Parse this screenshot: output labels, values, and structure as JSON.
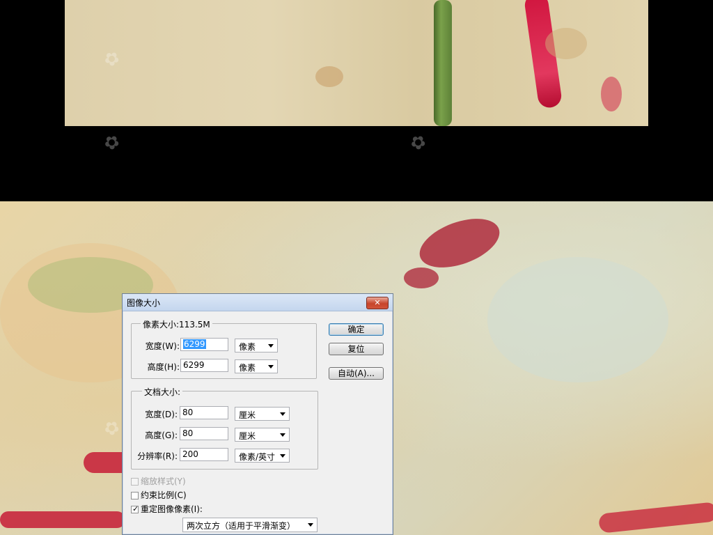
{
  "dialog": {
    "title": "图像大小",
    "close_icon": "close-icon",
    "pixel_dimensions": {
      "label": "像素大小:113.5M",
      "width_label": "宽度(W):",
      "width_value": "6299",
      "width_unit": "像素",
      "height_label": "高度(H):",
      "height_value": "6299",
      "height_unit": "像素"
    },
    "document_size": {
      "label": "文档大小:",
      "width_label": "宽度(D):",
      "width_value": "80",
      "width_unit": "厘米",
      "height_label": "高度(G):",
      "height_value": "80",
      "height_unit": "厘米",
      "resolution_label": "分辨率(R):",
      "resolution_value": "200",
      "resolution_unit": "像素/英寸"
    },
    "buttons": {
      "ok": "确定",
      "reset": "复位",
      "auto": "自动(A)..."
    },
    "options": {
      "scale_styles": "缩放样式(Y)",
      "scale_styles_checked": false,
      "scale_styles_disabled": true,
      "constrain": "约束比例(C)",
      "constrain_checked": false,
      "resample": "重定图像像素(I):",
      "resample_checked": true,
      "resample_method": "两次立方（适用于平滑渐变）"
    }
  },
  "colors": {
    "titlebar": "#c4d6ee",
    "dialog_bg": "#f0f0f0",
    "close_button": "#c7442b",
    "selection": "#3399ff"
  }
}
